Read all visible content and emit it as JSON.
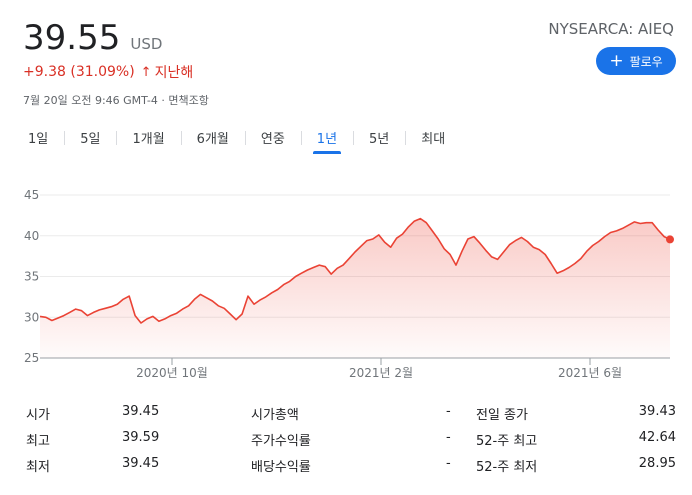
{
  "quote": {
    "price": "39.55",
    "currency": "USD",
    "ticker": "NYSEARCA: AIEQ",
    "change": "+9.38 (31.09%)",
    "change_arrow": "↑",
    "change_period": "지난해",
    "timestamp": "7월 20일 오전 9:46 GMT-4 · 면책조항",
    "follow_label": "팔로우",
    "up_color": "#d93025"
  },
  "tabs": [
    {
      "label": "1일"
    },
    {
      "label": "5일"
    },
    {
      "label": "1개월"
    },
    {
      "label": "6개월"
    },
    {
      "label": "연중"
    },
    {
      "label": "1년",
      "active": true
    },
    {
      "label": "5년"
    },
    {
      "label": "최대"
    }
  ],
  "chart_data": {
    "type": "area",
    "x_ticks": [
      "2020년 10월",
      "2021년 2월",
      "2021년 6월"
    ],
    "y_ticks": [
      25,
      30,
      35,
      40,
      45
    ],
    "ylim": [
      25,
      45
    ],
    "line_color": "#ea4335",
    "grid": true,
    "values": [
      30.1,
      30.0,
      29.6,
      29.9,
      30.2,
      30.6,
      31.0,
      30.8,
      30.2,
      30.6,
      30.9,
      31.1,
      31.3,
      31.6,
      32.2,
      32.6,
      30.2,
      29.3,
      29.8,
      30.1,
      29.5,
      29.8,
      30.2,
      30.5,
      31.0,
      31.4,
      32.2,
      32.8,
      32.4,
      32.0,
      31.4,
      31.1,
      30.4,
      29.7,
      30.4,
      32.6,
      31.6,
      32.1,
      32.5,
      33.0,
      33.4,
      34.0,
      34.4,
      35.0,
      35.4,
      35.8,
      36.1,
      36.4,
      36.2,
      35.3,
      36.0,
      36.4,
      37.2,
      38.0,
      38.7,
      39.4,
      39.6,
      40.1,
      39.2,
      38.6,
      39.7,
      40.2,
      41.1,
      41.8,
      42.1,
      41.6,
      40.6,
      39.6,
      38.4,
      37.7,
      36.4,
      38.1,
      39.6,
      39.9,
      39.1,
      38.2,
      37.4,
      37.1,
      38.0,
      38.9,
      39.4,
      39.8,
      39.3,
      38.6,
      38.3,
      37.7,
      36.6,
      35.4,
      35.7,
      36.1,
      36.6,
      37.2,
      38.1,
      38.8,
      39.3,
      39.9,
      40.4,
      40.6,
      40.9,
      41.3,
      41.7,
      41.5,
      41.6,
      41.6,
      40.7,
      39.9,
      39.55
    ]
  },
  "stats": [
    {
      "l1": "시가",
      "v1": "39.45",
      "l2": "시가총액",
      "v2": "-",
      "l3": "전일 종가",
      "v3": "39.43"
    },
    {
      "l1": "최고",
      "v1": "39.59",
      "l2": "주가수익률",
      "v2": "-",
      "l3": "52-주 최고",
      "v3": "42.64"
    },
    {
      "l1": "최저",
      "v1": "39.45",
      "l2": "배당수익률",
      "v2": "-",
      "l3": "52-주 최저",
      "v3": "28.95"
    }
  ]
}
